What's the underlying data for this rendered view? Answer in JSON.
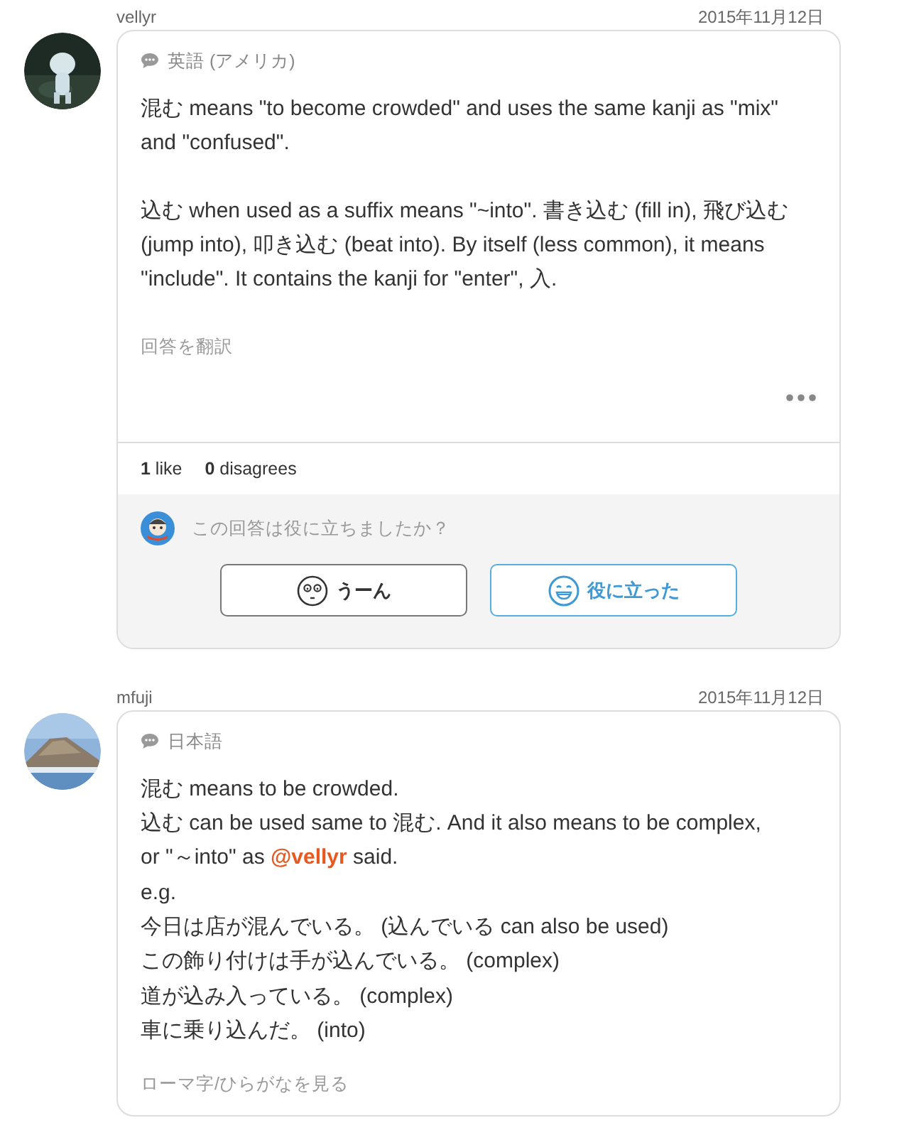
{
  "answers": [
    {
      "username": "vellyr",
      "date": "2015年11月12日",
      "language": "英語 (アメリカ)",
      "paragraphs": [
        "混む means \"to become crowded\" and uses the same kanji as \"mix\" and \"confused\".",
        "込む when used as a suffix means \"~into\". 書き込む (fill in), 飛び込む (jump into), 叩き込む (beat into). By itself (less common), it means \"include\". It contains the kanji for \"enter\", 入."
      ],
      "footer_link": "回答を翻訳",
      "more_menu": true,
      "reactions": {
        "likes_count": "1",
        "likes_label": "like",
        "disagrees_count": "0",
        "disagrees_label": "disagrees"
      },
      "feedback": {
        "question": "この回答は役に立ちましたか？",
        "buttons": [
          {
            "kind": "meh",
            "label": "うーん"
          },
          {
            "kind": "helpful",
            "label": "役に立った"
          }
        ]
      }
    },
    {
      "username": "mfuji",
      "date": "2015年11月12日",
      "language": "日本語",
      "lines": [
        {
          "text": "混む means to be crowded."
        },
        {
          "text": "込む can be used same to 混む. And it also means to be complex,"
        },
        {
          "text": "or \"～into\" as ",
          "mention": "@vellyr",
          "after": " said."
        },
        {
          "text": "e.g."
        },
        {
          "text": "今日は店が混んでいる。 (込んでいる can also be used)"
        },
        {
          "text": "この飾り付けは手が込んでいる。 (complex)"
        },
        {
          "text": "道が込み入っている。 (complex)"
        },
        {
          "text": "車に乗り込んだ。 (into)"
        }
      ],
      "footer_link": "ローマ字/ひらがなを見る",
      "more_menu": false
    }
  ]
}
